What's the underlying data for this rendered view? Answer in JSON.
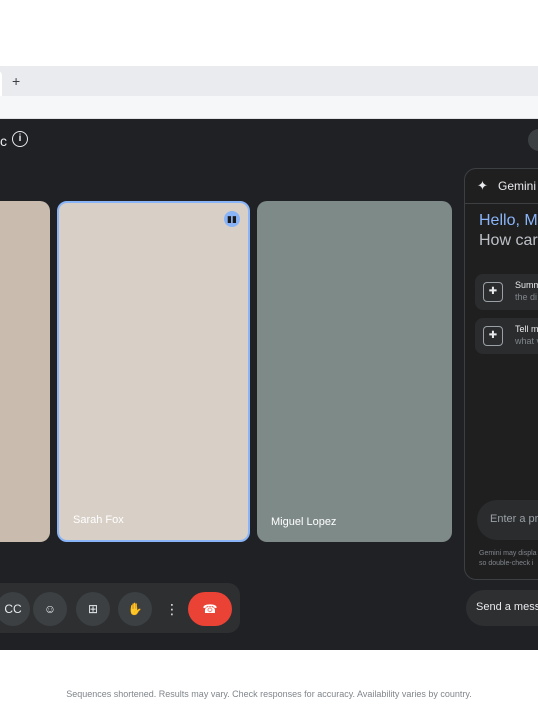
{
  "browser": {
    "new_tab_label": "+"
  },
  "meet": {
    "title_fragment": "c",
    "info_icon": "info-icon",
    "participants": [
      {
        "name": ""
      },
      {
        "name": "Sarah Fox",
        "speaking": true
      },
      {
        "name": "Miguel Lopez"
      }
    ],
    "controls": [
      {
        "icon": "captions-icon",
        "glyph": "CC"
      },
      {
        "icon": "emoji-icon",
        "glyph": "☺"
      },
      {
        "icon": "present-icon",
        "glyph": "⊞"
      },
      {
        "icon": "raise-hand-icon",
        "glyph": "✋"
      },
      {
        "icon": "more-options-icon",
        "glyph": "⋮"
      },
      {
        "icon": "end-call-icon",
        "glyph": "☎"
      }
    ]
  },
  "gemini": {
    "spark_icon": "✦",
    "title": "Gemini",
    "greeting": "Hello, M",
    "prompt": "How car",
    "suggestions": [
      {
        "title": "Summ",
        "subtitle": "the di"
      },
      {
        "title": "Tell m",
        "subtitle": "what v"
      }
    ],
    "input_placeholder": "Enter a pr",
    "disclaimer_line1": "Gemini may displa",
    "disclaimer_line2": "so double-check i",
    "send_label": "Send a mess"
  },
  "footnote": "Sequences shortened. Results may vary. Check responses for accuracy. Availability varies by country.",
  "colors": {
    "accent": "#8ab4f8",
    "end_call": "#ea4335",
    "surface": "#202124"
  }
}
